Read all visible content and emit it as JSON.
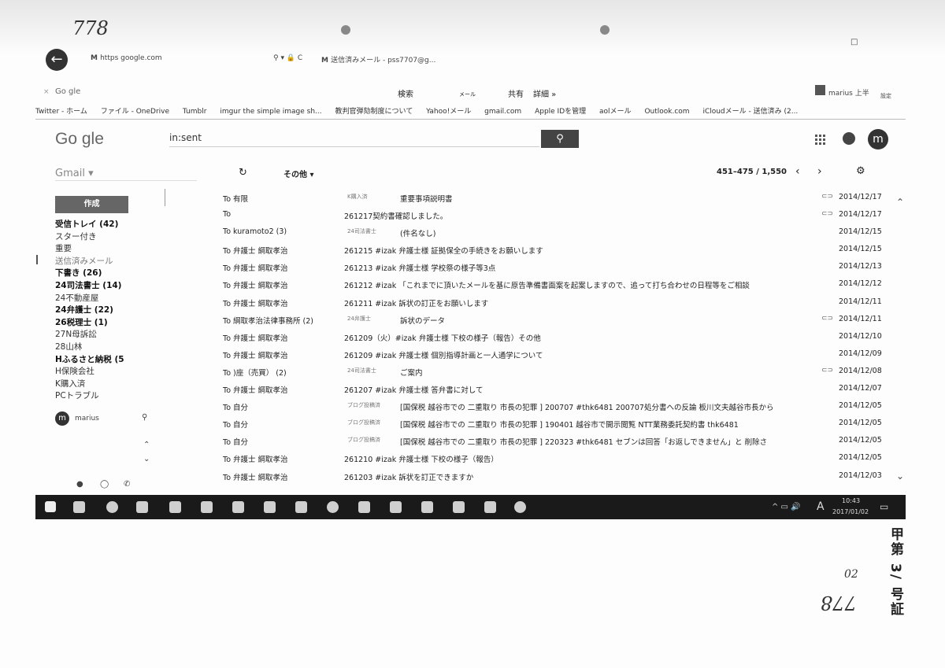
{
  "annotations": {
    "top_number": "778",
    "right_number": "778",
    "right_small": "02",
    "stamp": "甲第 3/ 号証"
  },
  "browser": {
    "url": "https  google.com",
    "tab_title": "送信済みメール - pss7707@g...",
    "toolbar_title": "Go gle",
    "toolbar_items": [
      "検索",
      "メール",
      "共有",
      "詳細 »"
    ],
    "user_label": "marius 上半",
    "settings_label": "設定",
    "bookmarks": [
      "Twitter - ホーム",
      "ファイル - OneDrive",
      "Tumblr",
      "imgur the simple image sh...",
      "教判官弾劾制度について",
      "Yahoo!メール",
      "gmail.com",
      "Apple IDを管理",
      "aolメール",
      "Outlook.com",
      "iCloudメール - 送信済み (2..."
    ]
  },
  "gmail": {
    "logo": "Go gle",
    "search_value": "in:sent",
    "search_icon": "search-icon",
    "app_label": "Gmail",
    "compose_label": "作成",
    "more_label": "その他",
    "pager": "451–475 / 1,550",
    "avatar_letter": "m",
    "account_name": "marius",
    "nav": [
      {
        "label": "受信トレイ (42)",
        "bold": true
      },
      {
        "label": "スター付き",
        "bold": false
      },
      {
        "label": "重要",
        "bold": false
      },
      {
        "label": "送信済みメール",
        "bold": false,
        "light": true
      },
      {
        "label": "下書き (26)",
        "bold": true
      },
      {
        "label": "24司法書士 (14)",
        "bold": true
      },
      {
        "label": "24不動産屋",
        "bold": false
      },
      {
        "label": "24弁護士 (22)",
        "bold": true
      },
      {
        "label": "26税理士 (1)",
        "bold": true
      },
      {
        "label": "27N母訴訟",
        "bold": false
      },
      {
        "label": "28山林",
        "bold": false
      },
      {
        "label": "Hふるさと納税 (5",
        "bold": true
      },
      {
        "label": "H保険会社",
        "bold": false
      },
      {
        "label": "K購入済",
        "bold": false
      },
      {
        "label": "PCトラブル",
        "bold": false
      }
    ],
    "rows": [
      {
        "to": "To  有限",
        "tag": "K購入済",
        "subject": "重要事項説明書",
        "clip": true,
        "date": "2014/12/17"
      },
      {
        "to": "To",
        "tag": "",
        "subject": "261217契約書確認しました。",
        "clip": true,
        "date": "2014/12/17"
      },
      {
        "to": "To  kuramoto2 (3)",
        "tag": "24司法書士",
        "subject": "(件名なし)",
        "clip": false,
        "date": "2014/12/15"
      },
      {
        "to": "To  弁護士 綱取孝治",
        "tag": "",
        "subject": "261215 #izak 弁護士様 証拠保全の手続きをお願いします",
        "clip": false,
        "date": "2014/12/15"
      },
      {
        "to": "To  弁護士 綱取孝治",
        "tag": "",
        "subject": "261213 #izak 弁護士様 学校祭の様子等3点",
        "clip": false,
        "date": "2014/12/13"
      },
      {
        "to": "To  弁護士 綱取孝治",
        "tag": "",
        "subject": "261212 #izak 「これまでに頂いたメールを基に原告準備書面案を起案しますので、追って打ち合わせの日程等をご相談",
        "clip": false,
        "date": "2014/12/12"
      },
      {
        "to": "To  弁護士 綱取孝治",
        "tag": "",
        "subject": "261211 #izak 訴状の訂正をお願いします",
        "clip": false,
        "date": "2014/12/11"
      },
      {
        "to": "To  綱取孝治法律事務所 (2)",
        "tag": "24弁護士",
        "subject": "訴状のデータ",
        "clip": true,
        "date": "2014/12/11"
      },
      {
        "to": "To  弁護士 綱取孝治",
        "tag": "",
        "subject": "261209（火）#izak 弁護士様 下校の様子（報告）その他",
        "clip": false,
        "date": "2014/12/10"
      },
      {
        "to": "To  弁護士 綱取孝治",
        "tag": "",
        "subject": "261209 #izak 弁護士様 個別指導計画と一人通学について",
        "clip": false,
        "date": "2014/12/09"
      },
      {
        "to": "To                )座（売買） (2)",
        "tag": "24司法書士",
        "subject": "ご案内",
        "clip": true,
        "date": "2014/12/08"
      },
      {
        "to": "To  弁護士 綱取孝治",
        "tag": "",
        "subject": "261207 #izak 弁護士様 答弁書に対して",
        "clip": false,
        "date": "2014/12/07"
      },
      {
        "to": "To  自分",
        "tag": "ブログ投稿済",
        "subject": "[国保税 越谷市での 二重取り 市長の犯罪 ] 200707 #thk6481 200707処分書への反論 板川文夫越谷市長から",
        "clip": false,
        "date": "2014/12/05"
      },
      {
        "to": "To  自分",
        "tag": "ブログ投稿済",
        "subject": "[国保税 越谷市での 二重取り 市長の犯罪 ] 190401 越谷市で開示閲覧 NTT業務委託契約書 thk6481",
        "clip": false,
        "date": "2014/12/05"
      },
      {
        "to": "To  自分",
        "tag": "ブログ投稿済",
        "subject": "[国保税 越谷市での 二重取り 市長の犯罪 ] 220323 #thk6481 セブンは回答「お返しできません」と 削除さ",
        "clip": false,
        "date": "2014/12/05"
      },
      {
        "to": "To  弁護士 綱取孝治",
        "tag": "",
        "subject": "261210 #izak 弁護士様 下校の様子（報告）",
        "clip": false,
        "date": "2014/12/05"
      },
      {
        "to": "To  弁護士 綱取孝治",
        "tag": "",
        "subject": "261203 #izak 訴状を訂正できますか",
        "clip": false,
        "date": "2014/12/03"
      }
    ]
  },
  "taskbar": {
    "ime": "A",
    "time": "10:43",
    "date": "2017/01/02"
  }
}
